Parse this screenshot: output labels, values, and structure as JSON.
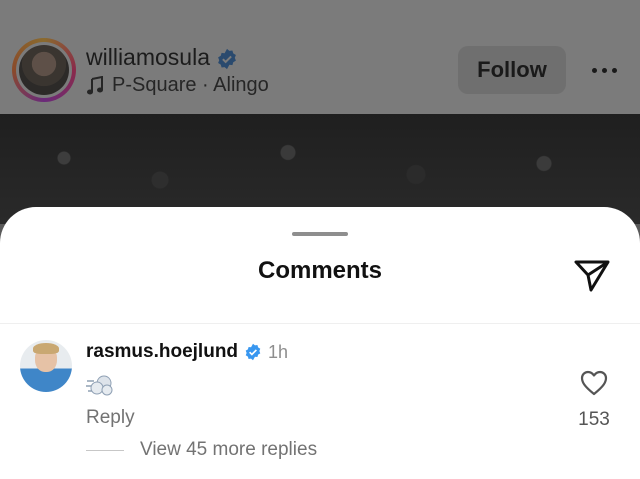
{
  "post": {
    "username": "williamosula",
    "music": "P-Square · Alingo",
    "follow_label": "Follow"
  },
  "comments_sheet": {
    "title": "Comments"
  },
  "comment": {
    "username": "rasmus.hoejlund",
    "time": "1h",
    "reply_label": "Reply",
    "view_replies_label": "View 45 more replies",
    "like_count": "153"
  },
  "colors": {
    "verified": "#3897f0",
    "muted_text": "#737373"
  }
}
